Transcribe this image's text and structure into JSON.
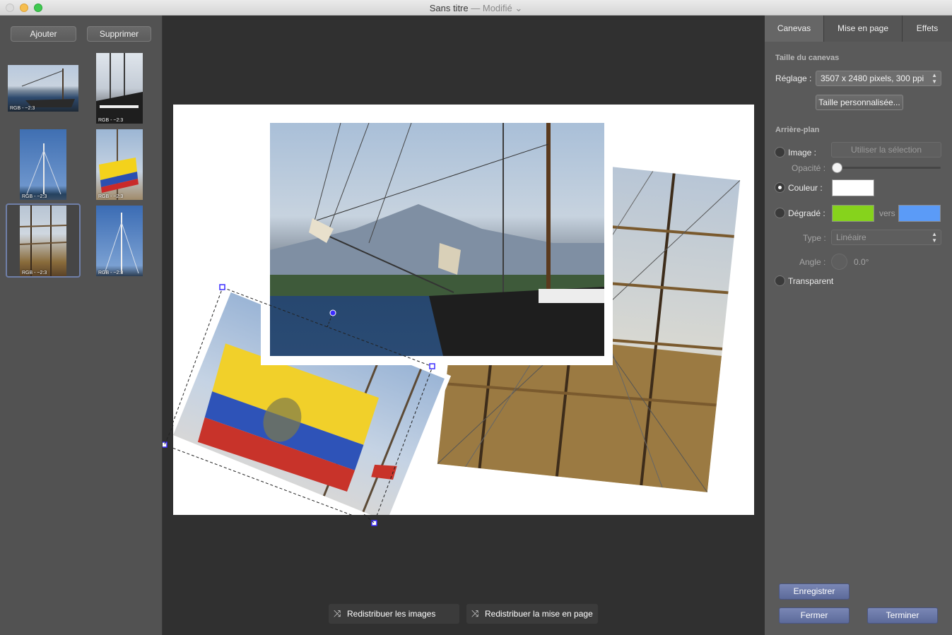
{
  "window": {
    "title": "Sans titre",
    "status": "— Modifié"
  },
  "sidebar": {
    "add_label": "Ajouter",
    "delete_label": "Supprimer",
    "thumbnails": [
      {
        "tag": "RGB - ~2:3",
        "subject": "tall ship with mountains",
        "selected": false
      },
      {
        "tag": "RGB - ~2:3",
        "subject": "ship hull and masts",
        "selected": false
      },
      {
        "tag": "RGB - ~2:3",
        "subject": "single mast against sky",
        "selected": false
      },
      {
        "tag": "RGB - ~2:3",
        "subject": "ecuador flag on rigging",
        "selected": false
      },
      {
        "tag": "RGB - ~2:3",
        "subject": "rigging detail",
        "selected": true
      },
      {
        "tag": "RGB - ~2:3",
        "subject": "mast against sky",
        "selected": false
      }
    ]
  },
  "canvas": {
    "background_color": "#ffffff",
    "photos": [
      "ship with mountains",
      "ship rigging",
      "ecuador flag"
    ],
    "selected_photo": "ecuador flag",
    "selection_color": "#3a2bff"
  },
  "bottom": {
    "redistribute_images": "Redistribuer les images",
    "redistribute_layout": "Redistribuer la mise en page"
  },
  "panel": {
    "tabs": [
      "Canevas",
      "Mise en page",
      "Effets"
    ],
    "active_tab": "Canevas",
    "canvas_size_section": "Taille du canevas",
    "preset_label": "Réglage :",
    "preset_value": "3507 x 2480 pixels, 300 ppi",
    "custom_size_button": "Taille personnalisée...",
    "background_section": "Arrière-plan",
    "image_label": "Image :",
    "use_selection_button": "Utiliser la sélection",
    "opacity_label": "Opacité :",
    "color_label": "Couleur :",
    "color_value": "#ffffff",
    "gradient_label": "Dégradé :",
    "gradient_from": "#86d31c",
    "gradient_to_label": "vers",
    "gradient_to": "#5b9bf7",
    "type_label": "Type :",
    "type_value": "Linéaire",
    "angle_label": "Angle :",
    "angle_value": "0.0°",
    "transparent_label": "Transparent",
    "background_mode": "Couleur",
    "save_button": "Enregistrer",
    "close_button": "Fermer",
    "finish_button": "Terminer"
  }
}
